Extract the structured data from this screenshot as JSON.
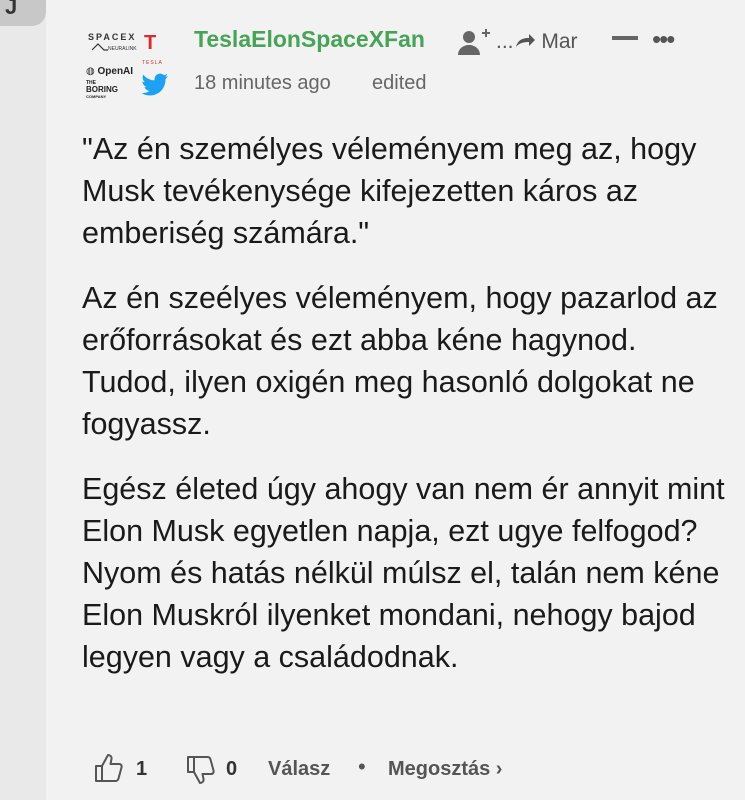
{
  "parent_stub": {
    "glyph": "J"
  },
  "author": {
    "name": "TeslaElonSpaceXFan",
    "flair": {
      "spacex": "SPACEX",
      "neuralink": "NEURALINK",
      "openai": "◍ OpenAI",
      "boring_line1": "THE",
      "boring_line2": "BORING",
      "boring_line3": "COMPANY",
      "tesla_logo": "T",
      "tesla_word": "TESLA"
    }
  },
  "header": {
    "follow_icon": "person-add-icon",
    "share_target_prefix": "...",
    "share_target": "Mar",
    "timestamp": "18 minutes ago",
    "edited_label": "edited",
    "more_label": "•••"
  },
  "paragraphs": [
    "\"Az én személyes véleményem meg az, hogy Musk tevékenysége kifejezetten káros az emberiség számára.\"",
    "Az én szeélyes véleményem, hogy pazarlod az erőforrásokat és ezt abba kéne hagynod. Tudod, ilyen oxigén meg hasonló dolgokat ne fogyassz.",
    "Egész életed úgy ahogy van nem ér annyit mint Elon Musk egyetlen napja, ezt ugye felfogod? Nyom és hatás nélkül múlsz el, talán nem kéne Elon Muskról ilyenket mondani, nehogy bajod legyen vagy a családodnak."
  ],
  "actions": {
    "upvote_count": "1",
    "downvote_count": "0",
    "reply_label": "Válasz",
    "separator": "•",
    "share_label": "Megosztás ›"
  },
  "colors": {
    "username": "#46a358",
    "tesla_red": "#d32f2f",
    "twitter_blue": "#1da1f2",
    "background": "#f2f2f2"
  }
}
